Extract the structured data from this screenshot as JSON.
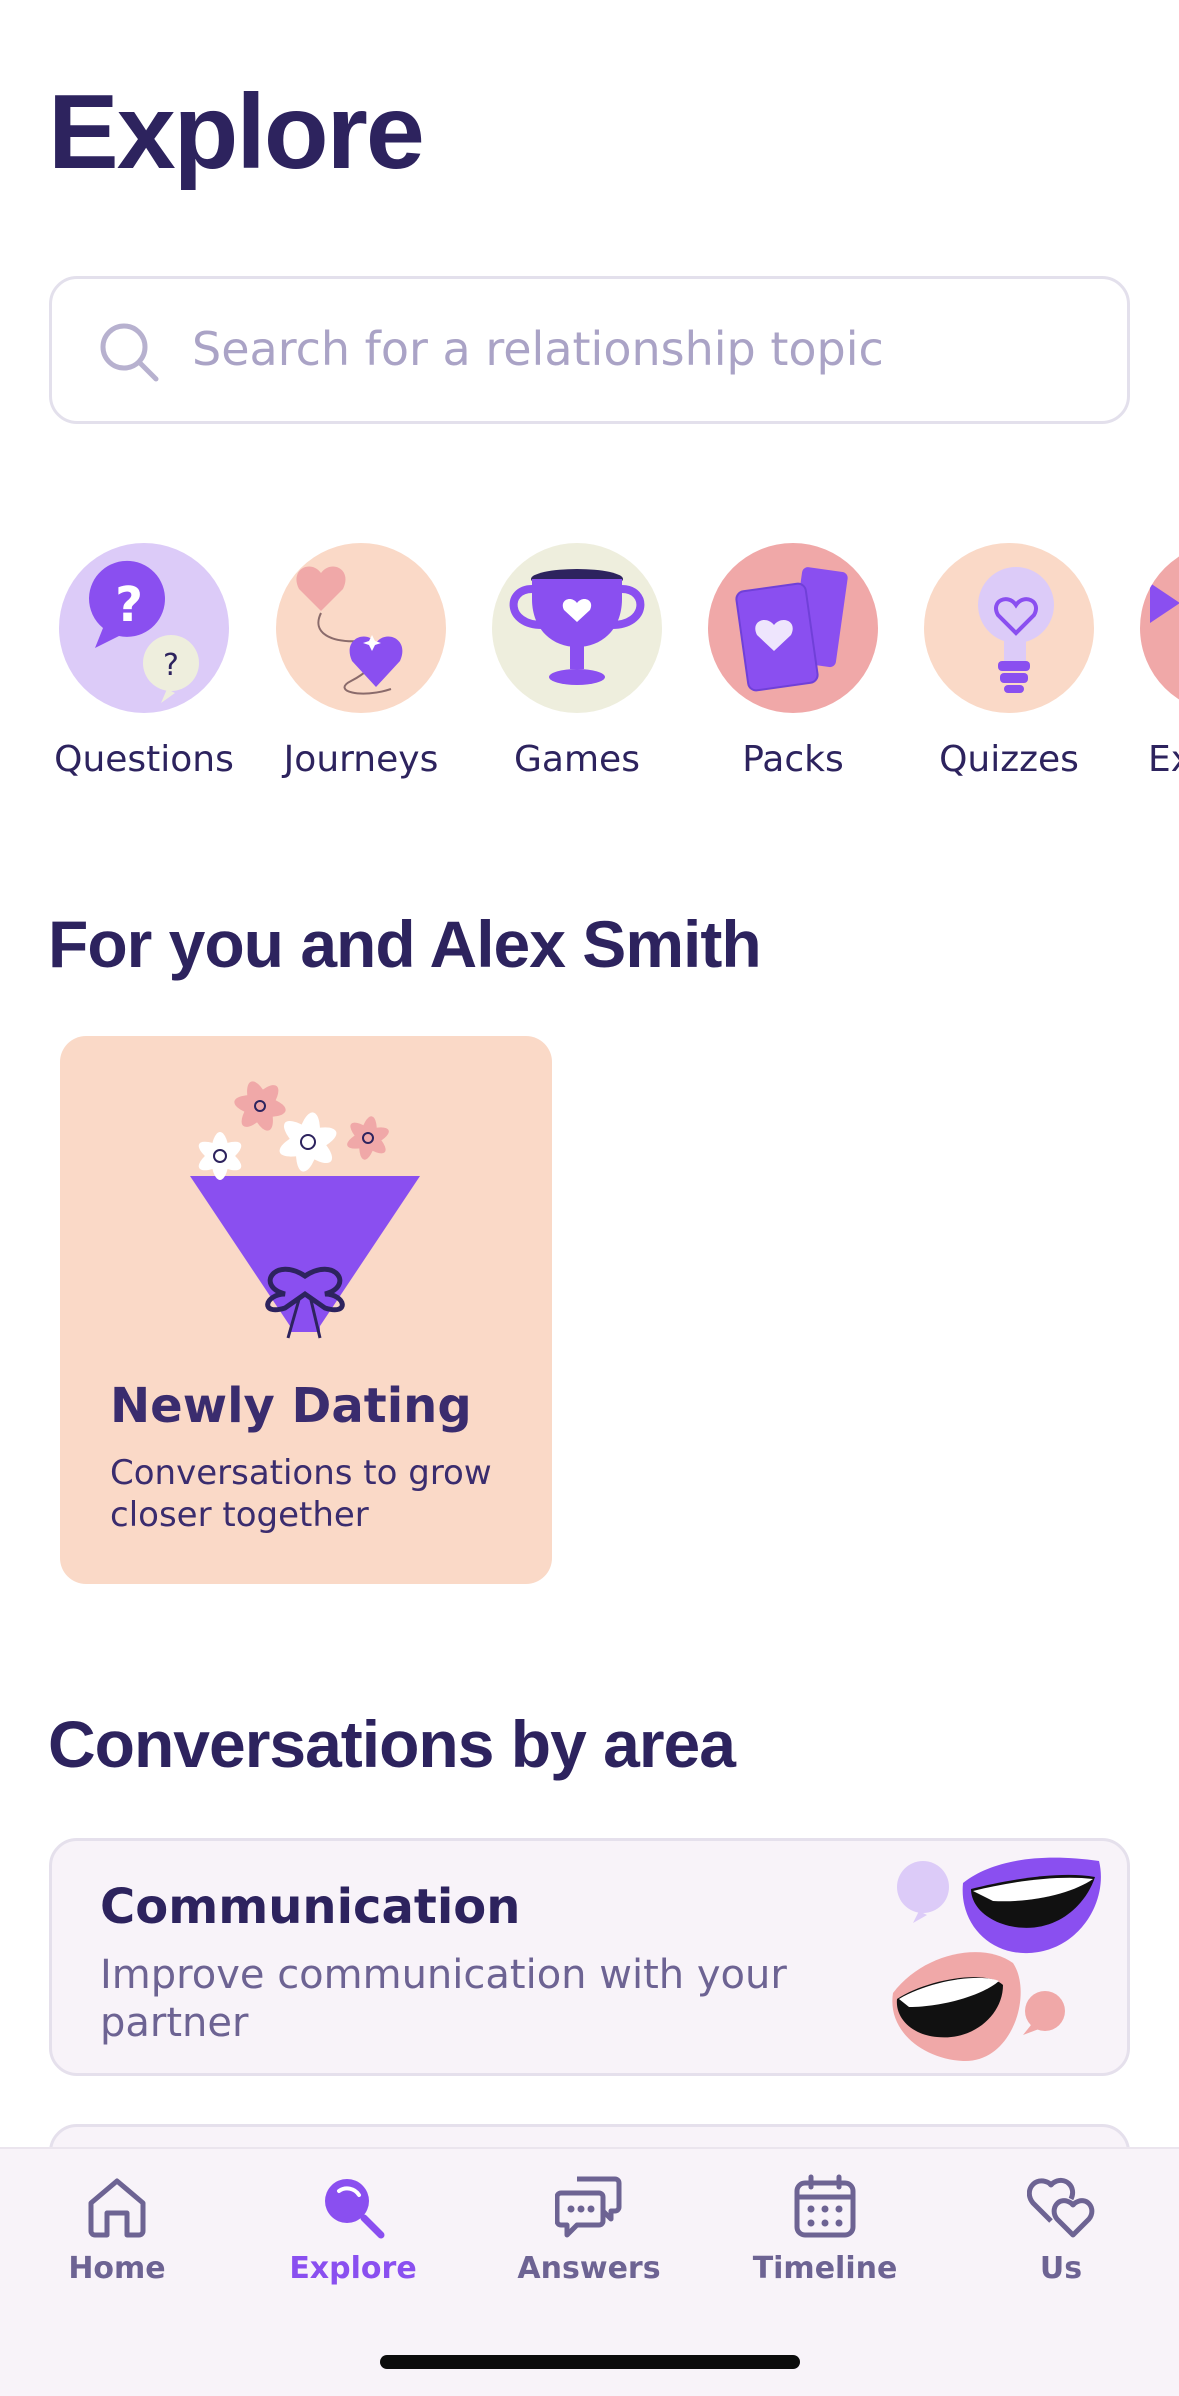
{
  "header": {
    "title": "Explore"
  },
  "search": {
    "placeholder": "Search for a relationship topic",
    "value": ""
  },
  "categories": [
    {
      "label": "Questions",
      "icon": "question-bubbles-icon",
      "bg": "#dccbf8"
    },
    {
      "label": "Journeys",
      "icon": "hearts-path-icon",
      "bg": "#fad9c7"
    },
    {
      "label": "Games",
      "icon": "trophy-icon",
      "bg": "#eeeedd"
    },
    {
      "label": "Packs",
      "icon": "card-pack-icon",
      "bg": "#f0a8a8"
    },
    {
      "label": "Quizzes",
      "icon": "lightbulb-icon",
      "bg": "#fad9c7"
    },
    {
      "label": "Ex",
      "icon": "partial-icon",
      "bg": "#f0a8a8"
    }
  ],
  "for_you": {
    "title": "For you and Alex Smith",
    "card": {
      "title": "Newly Dating",
      "subtitle": "Conversations to grow closer together",
      "icon": "bouquet-icon",
      "bg": "#fad9c7"
    }
  },
  "areas": {
    "title": "Conversations by area",
    "items": [
      {
        "title": "Communication",
        "description": "Improve communication with your partner",
        "icon": "talking-mouths-icon"
      }
    ]
  },
  "tabbar": {
    "active": "Explore",
    "items": [
      {
        "label": "Home",
        "icon": "home-icon"
      },
      {
        "label": "Explore",
        "icon": "explore-search-icon"
      },
      {
        "label": "Answers",
        "icon": "chat-bubbles-icon"
      },
      {
        "label": "Timeline",
        "icon": "calendar-icon"
      },
      {
        "label": "Us",
        "icon": "two-hearts-icon"
      }
    ]
  },
  "colors": {
    "primary_text": "#2d235e",
    "accent": "#8a4ff0",
    "muted_text": "#6d6393",
    "placeholder": "#aaa3c6"
  }
}
